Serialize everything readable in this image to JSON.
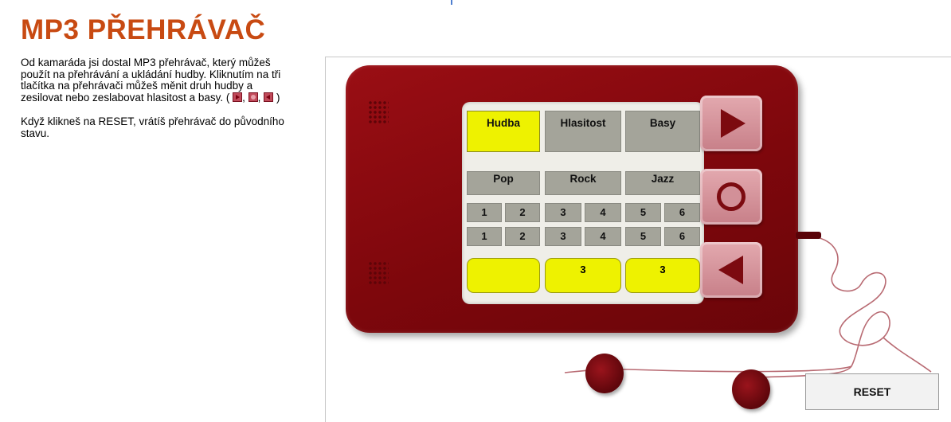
{
  "page": {
    "title": "MP3 PŘEHRÁVAČ",
    "intro_before_icons": "Od kamaráda jsi dostal MP3 přehrávač, který můžeš použít na přehrávání a ukládání hudby. Kliknutím na tři tlačítka na přehrávači můžeš měnit druh hudby a zesilovat nebo zeslabovat hlasitost a basy. ( ",
    "sep1": ", ",
    "sep2": ", ",
    "close_paren": " )",
    "reset_note": "Když klikneš na RESET, vrátíš přehrávač do původního stavu."
  },
  "player": {
    "modes": [
      {
        "label": "Hudba",
        "selected": true
      },
      {
        "label": "Hlasitost",
        "selected": false
      },
      {
        "label": "Basy",
        "selected": false
      }
    ],
    "genres": [
      "Pop",
      "Rock",
      "Jazz"
    ],
    "level_rows": [
      [
        "1",
        "2",
        "3",
        "4",
        "5",
        "6"
      ],
      [
        "1",
        "2",
        "3",
        "4",
        "5",
        "6"
      ]
    ],
    "readouts": [
      "",
      "3",
      "3"
    ],
    "side_buttons": {
      "top": "play-icon",
      "middle": "circle-icon",
      "bottom": "back-icon"
    },
    "reset_label": "RESET"
  },
  "colors": {
    "title": "#c84a12",
    "device": "#8a0a10",
    "highlight": "#eef200",
    "cell": "#a4a49a",
    "side_button": "#d6959c"
  }
}
